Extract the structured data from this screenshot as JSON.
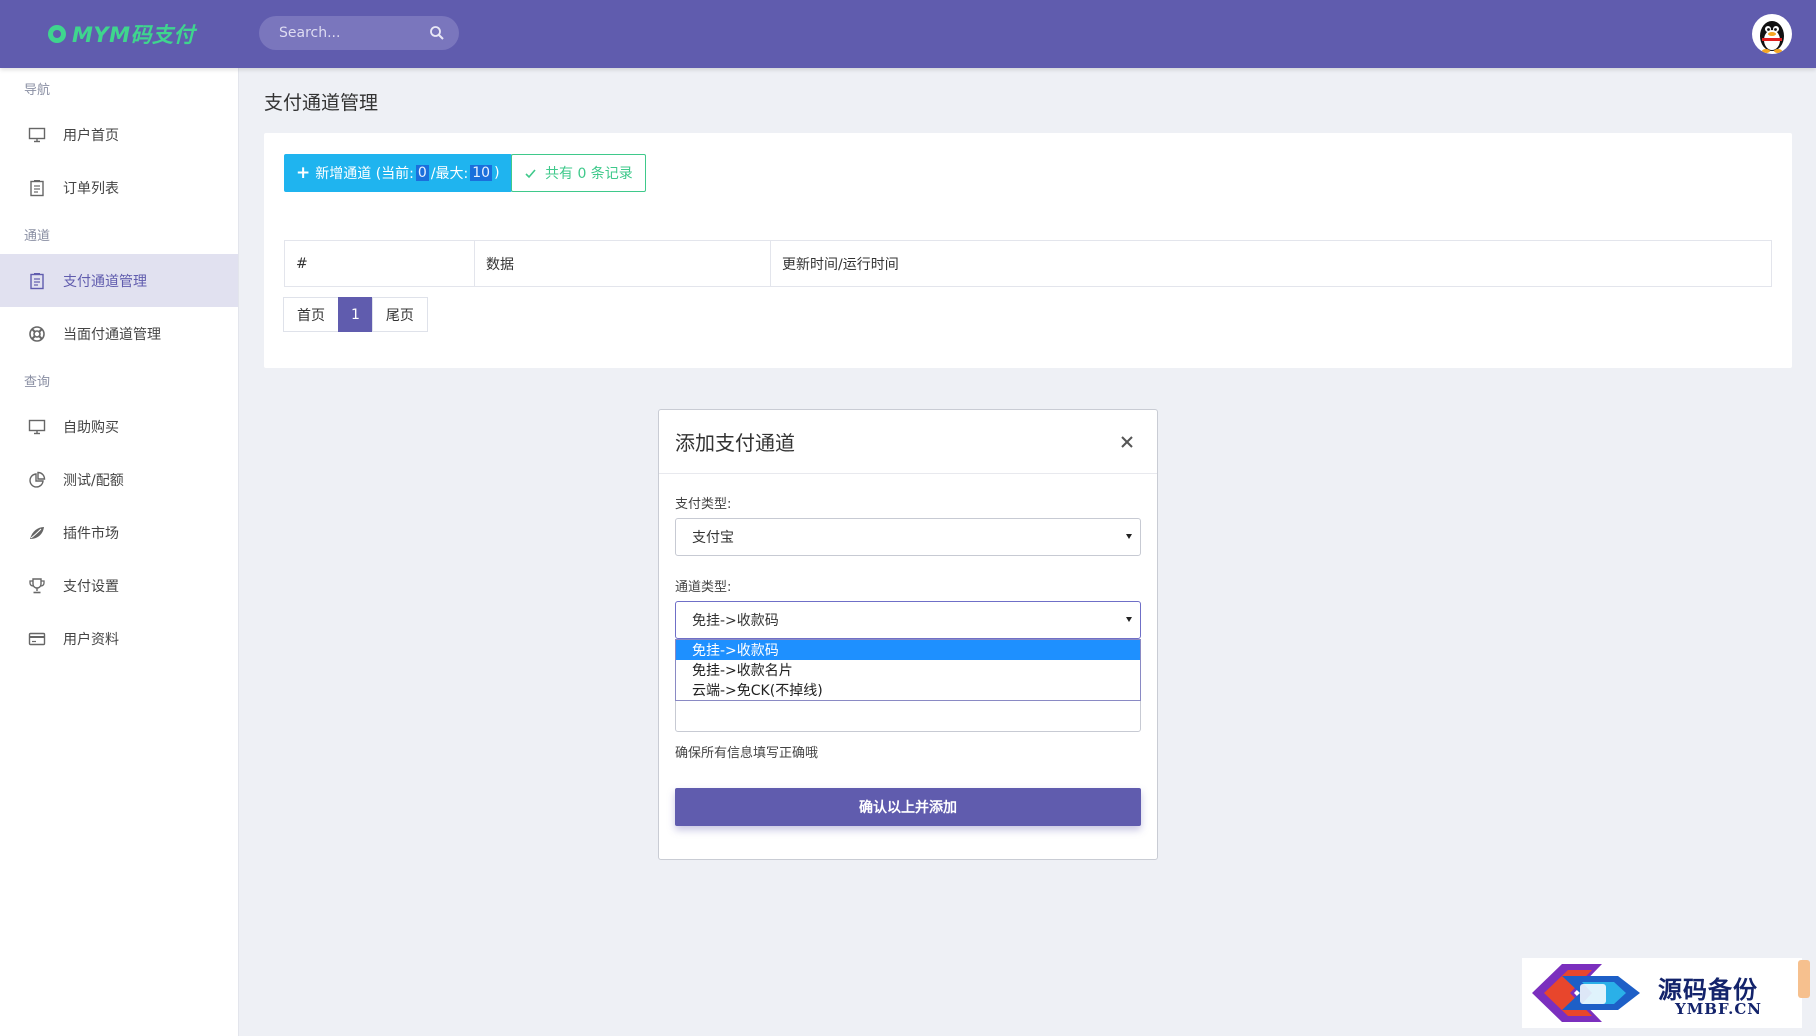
{
  "app": {
    "logo_text": "MYM码支付",
    "brand_color": "#605cae",
    "logo_color": "#3fd58e"
  },
  "search": {
    "placeholder": "Search..."
  },
  "sidebar": {
    "sections": [
      {
        "label": "导航",
        "items": [
          {
            "label": "用户首页",
            "icon": "monitor-icon"
          },
          {
            "label": "订单列表",
            "icon": "clipboard-icon"
          }
        ]
      },
      {
        "label": "通道",
        "items": [
          {
            "label": "支付通道管理",
            "icon": "clipboard-icon",
            "active": true
          },
          {
            "label": "当面付通道管理",
            "icon": "lifebuoy-icon"
          }
        ]
      },
      {
        "label": "查询",
        "items": [
          {
            "label": "自助购买",
            "icon": "monitor-icon"
          },
          {
            "label": "测试/配额",
            "icon": "pie-chart-icon"
          },
          {
            "label": "插件市场",
            "icon": "leaf-icon"
          },
          {
            "label": "支付设置",
            "icon": "trophy-icon"
          },
          {
            "label": "用户资料",
            "icon": "credit-card-icon"
          }
        ]
      }
    ]
  },
  "main": {
    "page_title": "支付通道管理",
    "add_button": {
      "prefix": "新增通道 (当前: ",
      "current": "0",
      "middle": "/最大: ",
      "max": "10",
      "suffix": ")"
    },
    "count_button": "共有 0 条记录",
    "table": {
      "headers": [
        "#",
        "数据",
        "更新时间/运行时间"
      ]
    },
    "pagination": {
      "first": "首页",
      "current": "1",
      "last": "尾页"
    }
  },
  "modal": {
    "title": "添加支付通道",
    "pay_type_label": "支付类型:",
    "pay_type_value": "支付宝",
    "channel_type_label": "通道类型:",
    "channel_type_value": "免挂->收款码",
    "channel_type_options": [
      "免挂->收款码",
      "免挂->收款名片",
      "云端->免CK(不掉线)"
    ],
    "hint": "确保所有信息填写正确哦",
    "confirm_label": "确认以上并添加"
  },
  "watermark": {
    "title": "源码备份",
    "subtitle": "YMBF.CN"
  }
}
